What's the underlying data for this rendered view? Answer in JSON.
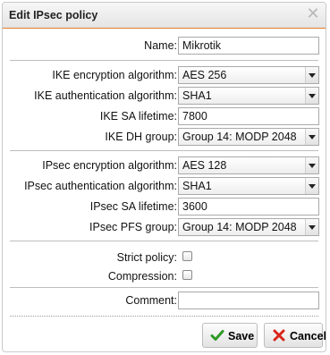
{
  "dialog": {
    "title": "Edit IPsec policy",
    "close_icon": "close-icon"
  },
  "form": {
    "name": {
      "label": "Name:",
      "value": "Mikrotik"
    },
    "ike_encryption": {
      "label": "IKE encryption algorithm:",
      "value": "AES 256"
    },
    "ike_authentication": {
      "label": "IKE authentication algorithm:",
      "value": "SHA1"
    },
    "ike_sa_lifetime": {
      "label": "IKE SA lifetime:",
      "value": "7800"
    },
    "ike_dh_group": {
      "label": "IKE DH group:",
      "value": "Group 14: MODP 2048"
    },
    "ipsec_encryption": {
      "label": "IPsec encryption algorithm:",
      "value": "AES 128"
    },
    "ipsec_authentication": {
      "label": "IPsec authentication algorithm:",
      "value": "SHA1"
    },
    "ipsec_sa_lifetime": {
      "label": "IPsec SA lifetime:",
      "value": "3600"
    },
    "ipsec_pfs_group": {
      "label": "IPsec PFS group:",
      "value": "Group 14: MODP 2048"
    },
    "strict_policy": {
      "label": "Strict policy:",
      "checked": false
    },
    "compression": {
      "label": "Compression:",
      "checked": false
    },
    "comment": {
      "label": "Comment:",
      "value": ""
    }
  },
  "buttons": {
    "save_label": "Save",
    "save_icon": "checkmark-icon",
    "cancel_label": "Cancel",
    "cancel_icon": "x-icon"
  },
  "colors": {
    "title_underline": "#e27d2c",
    "save_check": "#2e9a26",
    "cancel_x": "#d9251c"
  }
}
